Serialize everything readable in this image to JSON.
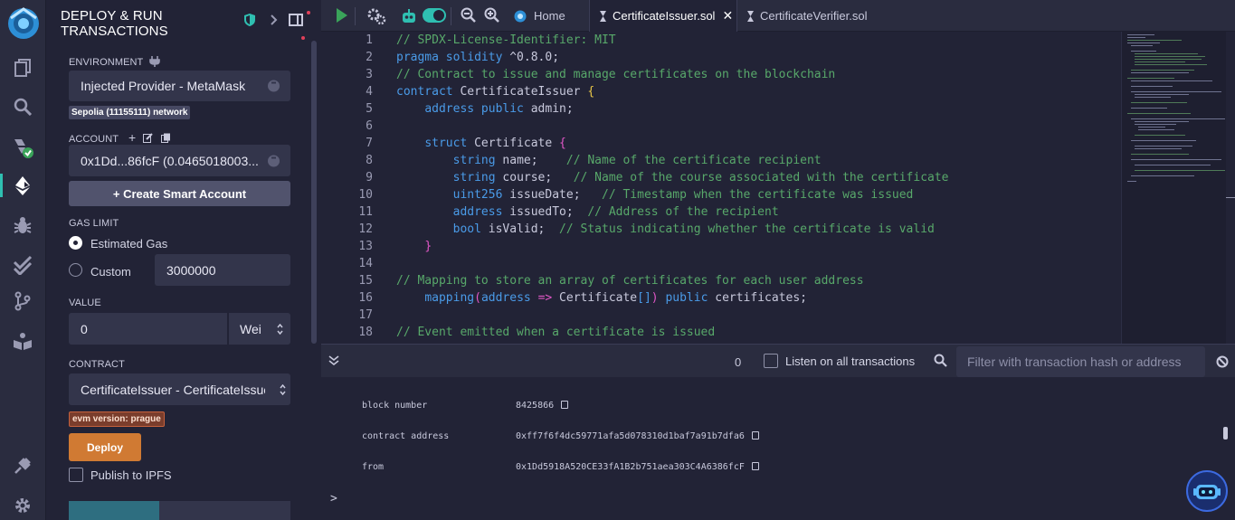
{
  "colors": {
    "accent": "#2fbfb1",
    "deploy": "#d07a33",
    "keyword": "#4a9be8",
    "comment": "#58a86a",
    "bracket": "#e157c7"
  },
  "rail": {
    "icons": [
      "remix-logo",
      "file-explorer-icon",
      "search-icon",
      "solidity-compiler-icon",
      "deploy-run-icon",
      "debugger-icon",
      "test-check-icon",
      "git-icon",
      "learneth-book-icon",
      "plugin-manager-icon",
      "settings-gear-icon"
    ]
  },
  "panel": {
    "title": "DEPLOY & RUN TRANSACTIONS",
    "environment": {
      "label": "ENVIRONMENT",
      "value": "Injected Provider - MetaMask",
      "network_badge": "Sepolia (11155111) network"
    },
    "account": {
      "label": "ACCOUNT",
      "value": "0x1Dd...86fcF (0.0465018003..."
    },
    "create_account_button": "+ Create Smart Account",
    "gas": {
      "label": "GAS LIMIT",
      "estimated": "Estimated Gas",
      "custom": "Custom",
      "custom_value": "3000000",
      "selected": "Estimated Gas"
    },
    "value": {
      "label": "VALUE",
      "amount": "0",
      "unit": "Wei"
    },
    "contract": {
      "label": "CONTRACT",
      "value": "CertificateIssuer - CertificateIssuer.sol",
      "evm_badge": "evm version: prague"
    },
    "deploy_button": "Deploy",
    "publish_ipfs": "Publish to IPFS"
  },
  "tabs": {
    "home": "Home",
    "active_file": "CertificateIssuer.sol",
    "other_file": "CertificateVerifier.sol",
    "close": "✕"
  },
  "editor": {
    "line_numbers": [
      "1",
      "2",
      "3",
      "4",
      "5",
      "6",
      "7",
      "8",
      "9",
      "10",
      "11",
      "12",
      "13",
      "14",
      "15",
      "16",
      "17",
      "18"
    ]
  },
  "terminal": {
    "pending_count": "0",
    "listen_label": "Listen on all transactions",
    "filter_placeholder": "Filter with transaction hash or address",
    "rows": [
      {
        "key": "block number",
        "value": "8425866"
      },
      {
        "key": "contract address",
        "value": "0xff7f6f4dc59771afa5d078310d1baf7a91b7dfa6"
      },
      {
        "key": "from",
        "value": "0x1Dd5918A520CE33fA1B2b751aea303C4A6386fcF"
      }
    ],
    "prompt": ">"
  }
}
